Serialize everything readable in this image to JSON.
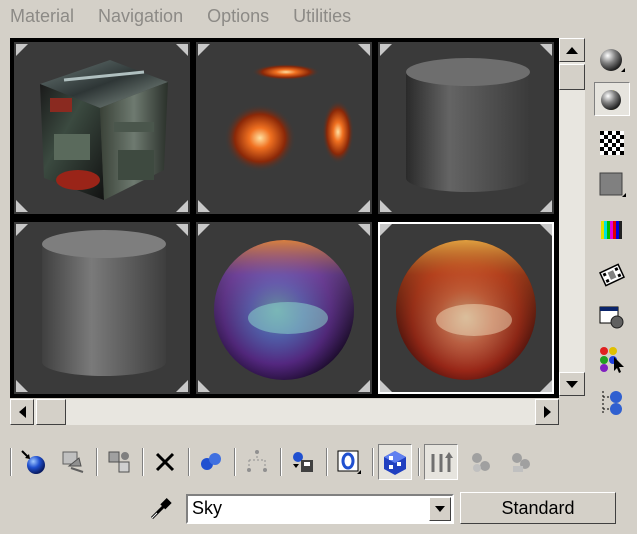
{
  "menu": {
    "items": [
      "Material",
      "Navigation",
      "Options",
      "Utilities"
    ]
  },
  "slots": [
    {
      "name": "slot-1",
      "preview": "textured-cube",
      "active": false
    },
    {
      "name": "slot-2",
      "preview": "fire-particles",
      "active": false
    },
    {
      "name": "slot-3",
      "preview": "gray-cylinder",
      "active": false
    },
    {
      "name": "slot-4",
      "preview": "gray-cylinder",
      "active": false
    },
    {
      "name": "slot-5",
      "preview": "blue-sky-sphere",
      "active": false
    },
    {
      "name": "slot-6",
      "preview": "red-sky-sphere",
      "active": true
    }
  ],
  "sidebar": {
    "icons": [
      "sample-type-icon",
      "backlight-icon",
      "checker-background-icon",
      "sample-uv-tiling-icon",
      "video-color-check-icon",
      "make-preview-icon",
      "options-icon",
      "select-by-material-icon",
      "material-map-navigator-icon"
    ]
  },
  "toolbar": {
    "icons": [
      "get-material-icon",
      "put-material-icon",
      "assign-material-icon",
      "reset-map-icon",
      "make-unique-icon",
      "put-to-library-icon",
      "material-effects-channel-icon",
      "show-map-in-viewport-icon",
      "show-end-result-icon",
      "go-to-parent-icon",
      "go-forward-to-sibling-icon"
    ]
  },
  "material": {
    "name": "Sky",
    "type_label": "Standard"
  },
  "colors": {
    "background": "#d4d0c8",
    "slot_bg": "#3a3a3a",
    "grid_border": "#000000"
  }
}
